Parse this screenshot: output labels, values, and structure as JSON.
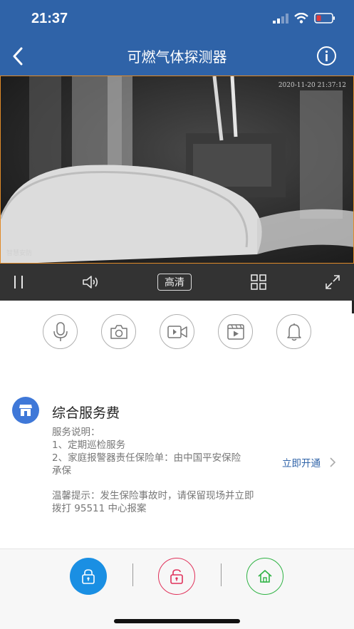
{
  "status_bar": {
    "time": "21:37",
    "signal_icon": "signal-icon",
    "wifi_icon": "wifi-icon",
    "battery_icon": "battery-icon"
  },
  "header": {
    "title": "可燃气体探测器",
    "back_icon": "back-chevron-icon",
    "info_icon": "info-icon",
    "background": "#2f63a8"
  },
  "video": {
    "timestamp": "2020-11-20  21:37:12",
    "watermark": "智慧安防",
    "border_color": "#e08a28"
  },
  "controls": {
    "hd_label": "高清",
    "pause_icon": "pause-icon",
    "volume_icon": "volume-icon",
    "grid_icon": "grid-icon",
    "fullscreen_icon": "fullscreen-icon"
  },
  "actions": [
    "microphone-icon",
    "camera-icon",
    "video-record-icon",
    "playback-icon",
    "bell-icon"
  ],
  "service": {
    "title": "综合服务费",
    "desc_heading": "服务说明：",
    "line1": "1、定期巡检服务",
    "line2a": "2、家庭报警器责任保险单：由中国平安保险",
    "line2b": "承保",
    "tip_a": "温馨提示：发生保险事故时，请保留现场并立即",
    "tip_b": "拨打 95511 中心报案",
    "open_label": "立即开通",
    "accent": "#2f63a8"
  },
  "bottom": {
    "arm_color": "#1a8fe3",
    "disarm_color": "#e0315a",
    "home_color": "#2fb344"
  }
}
